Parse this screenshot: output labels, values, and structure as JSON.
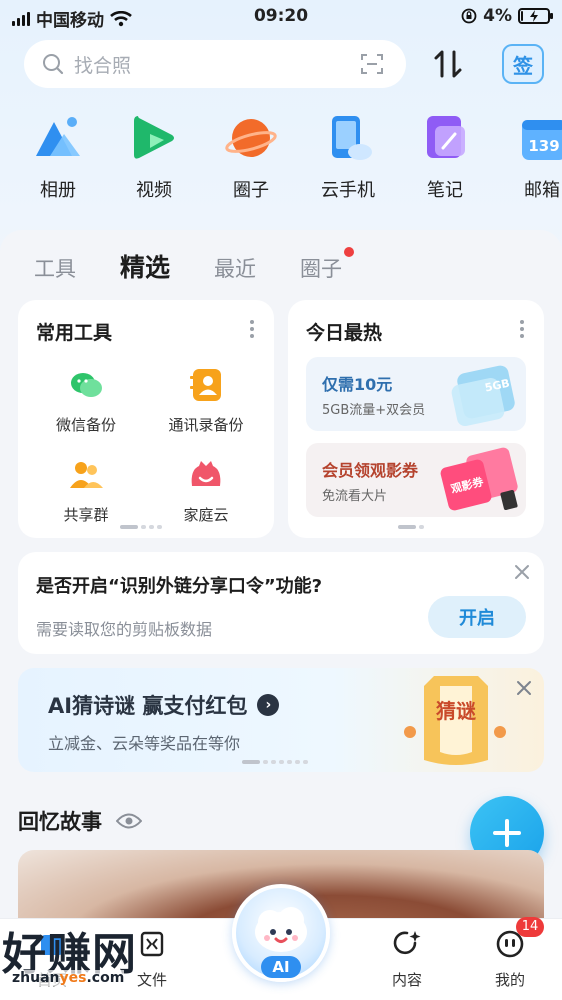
{
  "status_bar": {
    "carrier": "中国移动",
    "time": "09:20",
    "battery": "4%",
    "battery_level": 0.04
  },
  "search": {
    "placeholder": "找合照",
    "sign_label": "签"
  },
  "shortcuts": [
    {
      "label": "相册",
      "icon": "photo-album-icon"
    },
    {
      "label": "视频",
      "icon": "video-play-icon"
    },
    {
      "label": "圈子",
      "icon": "planet-icon"
    },
    {
      "label": "云手机",
      "icon": "cloud-phone-icon"
    },
    {
      "label": "笔记",
      "icon": "notes-icon"
    },
    {
      "label": "邮箱",
      "icon": "mail-calendar-icon",
      "badge": "139"
    }
  ],
  "tabs": [
    {
      "label": "工具"
    },
    {
      "label": "精选",
      "active": true
    },
    {
      "label": "最近"
    },
    {
      "label": "圈子",
      "dot": true
    }
  ],
  "common_tools": {
    "title": "常用工具",
    "items": [
      {
        "label": "微信备份",
        "icon": "wechat-icon"
      },
      {
        "label": "通讯录备份",
        "icon": "contacts-icon"
      },
      {
        "label": "共享群",
        "icon": "group-icon"
      },
      {
        "label": "家庭云",
        "icon": "family-cloud-icon"
      }
    ]
  },
  "today_hot": {
    "title": "今日最热",
    "promos": [
      {
        "title": "仅需10元",
        "subtitle": "5GB流量+双会员",
        "art_text": "5GB"
      },
      {
        "title": "会员领观影券",
        "subtitle": "免流看大片",
        "art_text": "观影券"
      }
    ]
  },
  "clipboard_notice": {
    "title": "是否开启“识别外链分享口令”功能?",
    "subtitle": "需要读取您的剪贴板数据",
    "button": "开启"
  },
  "ai_banner": {
    "title": "AI猜诗谜  赢支付红包",
    "subtitle": "立减金、云朵等奖品在等你",
    "art_text": "猜谜"
  },
  "memories": {
    "title": "回忆故事"
  },
  "bottom_nav": [
    {
      "label": "首页"
    },
    {
      "label": "文件"
    },
    {
      "label": "AI"
    },
    {
      "label": "内容"
    },
    {
      "label": "我的",
      "badge": "14"
    }
  ],
  "watermark": {
    "text": "好赚网",
    "url_a": "zhuan",
    "url_b": "yes",
    "url_c": ".com"
  },
  "colors": {
    "accent": "#1aa2ea",
    "badge_red": "#ee3a3a",
    "tab_active": "#1d1d1d"
  }
}
